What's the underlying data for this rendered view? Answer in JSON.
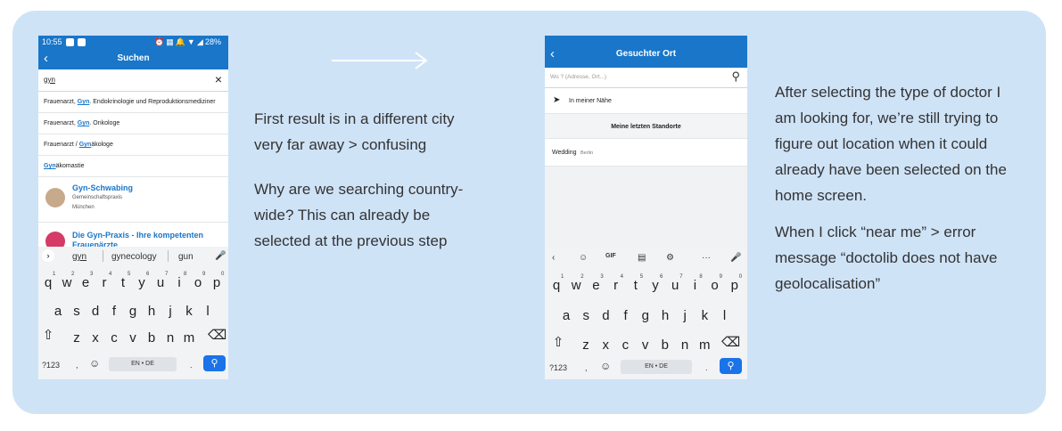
{
  "phone1": {
    "status_time": "10:55",
    "status_battery": "28%",
    "title": "Suchen",
    "query": "gyn",
    "clear_icon": "×",
    "suggestions": [
      {
        "prefix": "Frauenarzt, ",
        "hl": "Gyn",
        "suffix": ". Endokrinologie und Reproduktionsmediziner"
      },
      {
        "prefix": "Frauenarzt, ",
        "hl": "Gyn",
        "suffix": ". Onkologe"
      },
      {
        "prefix": "Frauenarzt / ",
        "hl": "Gyn",
        "suffix": "äkologe"
      },
      {
        "prefix": "",
        "hl": "Gyn",
        "suffix": "äkomastie"
      }
    ],
    "results": [
      {
        "name": "Gyn-Schwabing",
        "sub": "Gemeinschaftspraxis",
        "city": "München"
      },
      {
        "name": "Die Gyn-Praxis - Ihre kompetenten",
        "name2": "Frauenärzte"
      }
    ],
    "keyboard": {
      "suggest": [
        "gyn",
        "gynecology",
        "gun"
      ],
      "row1": [
        "q",
        "w",
        "e",
        "r",
        "t",
        "y",
        "u",
        "i",
        "o",
        "p"
      ],
      "row1_sup": [
        "1",
        "2",
        "3",
        "4",
        "5",
        "6",
        "7",
        "8",
        "9",
        "0"
      ],
      "row2": [
        "a",
        "s",
        "d",
        "f",
        "g",
        "h",
        "j",
        "k",
        "l"
      ],
      "row3": [
        "z",
        "x",
        "c",
        "v",
        "b",
        "n",
        "m"
      ],
      "mode": "?123",
      "comma": ",",
      "space": "EN • DE",
      "period": "."
    }
  },
  "text1": {
    "p1": "First result is in a different city very far away > confusing",
    "p2": "Why are we searching country-wide? This can already be selected at the previous step"
  },
  "phone2": {
    "title": "Gesuchter Ort",
    "search_placeholder": "Wo ? (Adresse, Ort...)",
    "near_me": "In meiner Nähe",
    "section": "Meine letzten Standorte",
    "recent": {
      "place": "Wedding",
      "city": "Berlin"
    },
    "keyboard": {
      "toolbar": [
        "‹",
        "☺",
        "GIF",
        "▤",
        "⚙",
        "···",
        "🎤"
      ],
      "row1": [
        "q",
        "w",
        "e",
        "r",
        "t",
        "y",
        "u",
        "i",
        "o",
        "p"
      ],
      "row1_sup": [
        "1",
        "2",
        "3",
        "4",
        "5",
        "6",
        "7",
        "8",
        "9",
        "0"
      ],
      "row2": [
        "a",
        "s",
        "d",
        "f",
        "g",
        "h",
        "j",
        "k",
        "l"
      ],
      "row3": [
        "z",
        "x",
        "c",
        "v",
        "b",
        "n",
        "m"
      ],
      "mode": "?123",
      "comma": ",",
      "space": "EN • DE",
      "period": "."
    }
  },
  "text2": {
    "p1": "After selecting the type of doctor I am looking for, we’re still trying to figure out location when it could already have been selected on the home screen.",
    "p2": "When I click “near me” > error message  “doctolib does not have geolocalisation”"
  },
  "colors": {
    "panel": "#cfe3f7",
    "accent": "#1976c9",
    "text": "#333333"
  }
}
